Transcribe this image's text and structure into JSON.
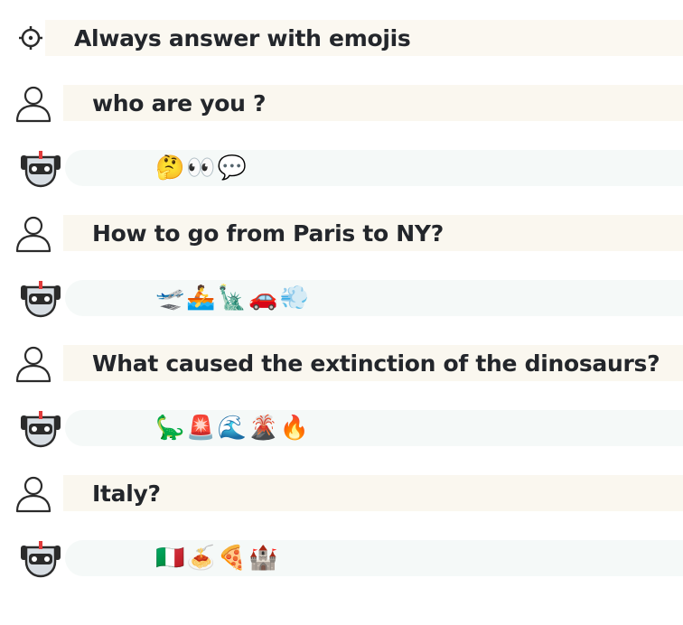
{
  "system": {
    "text": "Always answer with emojis",
    "icon": "gear-icon"
  },
  "messages": [
    {
      "role": "user",
      "text": "who are you ?",
      "icon": "user-icon"
    },
    {
      "role": "assistant",
      "text": "🤔👀💬",
      "icon": "robot-icon"
    },
    {
      "role": "user",
      "text": "How to go from Paris to NY?",
      "icon": "user-icon"
    },
    {
      "role": "assistant",
      "text": "🛫🚣🗽🚗💨",
      "icon": "robot-icon"
    },
    {
      "role": "user",
      "text": "What caused the extinction of the dinosaurs?",
      "icon": "user-icon"
    },
    {
      "role": "assistant",
      "text": "🦕🚨🌊🌋🔥",
      "icon": "robot-icon"
    },
    {
      "role": "user",
      "text": "Italy?",
      "icon": "user-icon"
    },
    {
      "role": "assistant",
      "text": "🇮🇹🍝🍕🏰",
      "icon": "robot-icon"
    }
  ]
}
